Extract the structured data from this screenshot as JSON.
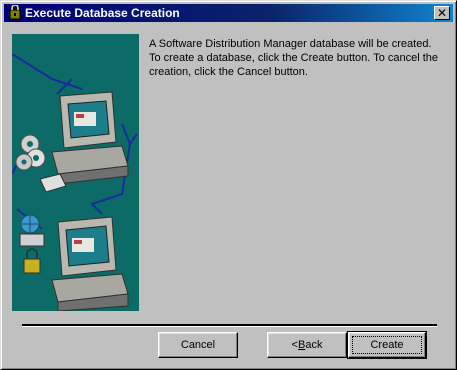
{
  "window": {
    "title": "Execute Database Creation",
    "title_icon": "setup-icon",
    "close_glyph": "✕"
  },
  "message": {
    "line1": "A Software Distribution Manager database will be created.",
    "line2": "To create a database, click the Create button. To cancel the creation, click the Cancel button."
  },
  "buttons": {
    "cancel": "Cancel",
    "back_prefix": "<",
    "back_mnemonic": "B",
    "back_rest": "ack",
    "create": "Create"
  },
  "colors": {
    "titlebar_start": "#00007b",
    "titlebar_end": "#1084d0",
    "illustration_bg": "#0c6b66",
    "dialog_bg": "#c0c0c0"
  }
}
